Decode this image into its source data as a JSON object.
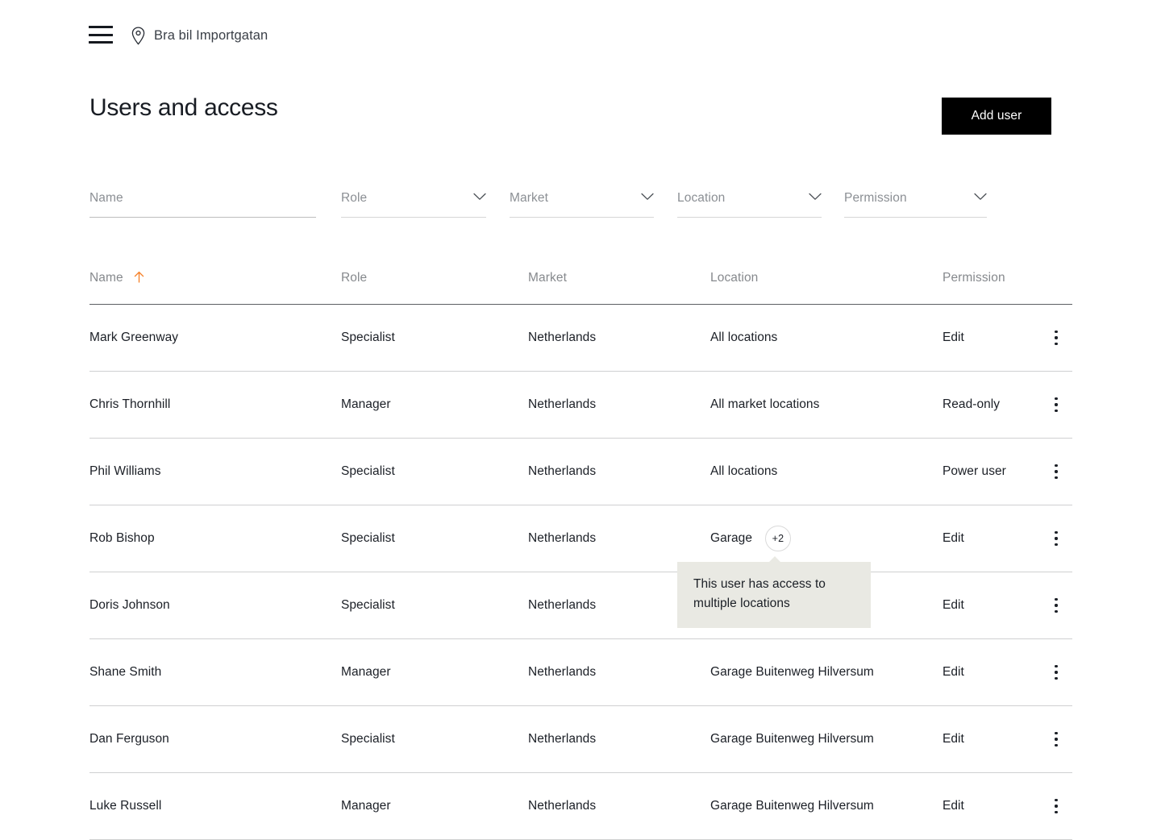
{
  "topbar": {
    "menu_icon": "hamburger-icon",
    "location_icon": "map-pin-icon",
    "location_name": "Bra bil Importgatan"
  },
  "header": {
    "title": "Users and access",
    "add_user_label": "Add user"
  },
  "filters": [
    {
      "id": "name",
      "label": "Name",
      "value": "",
      "placeholder": "Name",
      "type": "text",
      "active": true
    },
    {
      "id": "role",
      "label": "Role",
      "value": "",
      "placeholder": "Role",
      "type": "select",
      "active": false
    },
    {
      "id": "market",
      "label": "Market",
      "value": "",
      "placeholder": "Market",
      "type": "select",
      "active": false
    },
    {
      "id": "location",
      "label": "Location",
      "value": "",
      "placeholder": "Location",
      "type": "select",
      "active": false
    },
    {
      "id": "permission",
      "label": "Permission",
      "value": "",
      "placeholder": "Permission",
      "type": "select",
      "active": false
    }
  ],
  "table": {
    "columns": [
      {
        "key": "name",
        "label": "Name",
        "sorted": true,
        "sort_direction": "asc"
      },
      {
        "key": "role",
        "label": "Role",
        "sorted": false
      },
      {
        "key": "market",
        "label": "Market",
        "sorted": false
      },
      {
        "key": "location",
        "label": "Location",
        "sorted": false
      },
      {
        "key": "permission",
        "label": "Permission",
        "sorted": false
      }
    ],
    "rows": [
      {
        "name": "Mark Greenway",
        "role": "Specialist",
        "market": "Netherlands",
        "location": "All locations",
        "badge": "",
        "permission": "Edit"
      },
      {
        "name": "Chris Thornhill",
        "role": "Manager",
        "market": "Netherlands",
        "location": "All market locations",
        "badge": "",
        "permission": "Read-only"
      },
      {
        "name": "Phil Williams",
        "role": "Specialist",
        "market": "Netherlands",
        "location": "All locations",
        "badge": "",
        "permission": "Power user"
      },
      {
        "name": "Rob Bishop",
        "role": "Specialist",
        "market": "Netherlands",
        "location": "Garage",
        "badge": "+2",
        "permission": "Edit"
      },
      {
        "name": "Doris Johnson",
        "role": "Specialist",
        "market": "Netherlands",
        "location": "",
        "badge": "",
        "permission": "Edit"
      },
      {
        "name": "Shane Smith",
        "role": "Manager",
        "market": "Netherlands",
        "location": "Garage Buitenweg Hilversum",
        "badge": "",
        "permission": "Edit"
      },
      {
        "name": "Dan Ferguson",
        "role": "Specialist",
        "market": "Netherlands",
        "location": "Garage Buitenweg Hilversum",
        "badge": "",
        "permission": "Edit"
      },
      {
        "name": "Luke Russell",
        "role": "Manager",
        "market": "Netherlands",
        "location": "Garage Buitenweg Hilversum",
        "badge": "",
        "permission": "Edit"
      }
    ],
    "row_menu_icon": "kebab-menu-icon"
  },
  "tooltip": {
    "visible": true,
    "text": "This user has access to multiple locations",
    "anchor_row": "Rob Bishop"
  },
  "colors": {
    "accent_sort": "#F5822A",
    "button_bg": "#000000",
    "button_text": "#FFFFFF",
    "text_primary": "#1B1F26",
    "text_muted": "#86898D",
    "tooltip_bg": "#E9E9E3",
    "row_divider": "#CFD0D1",
    "header_divider": "#5C5F63"
  }
}
